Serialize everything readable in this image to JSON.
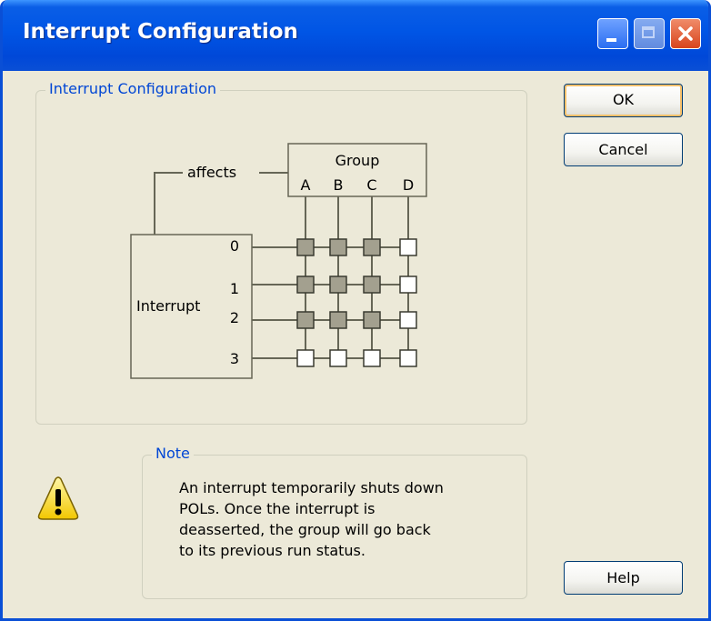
{
  "window": {
    "title": "Interrupt Configuration"
  },
  "config_group": {
    "legend": "Interrupt Configuration"
  },
  "diagram": {
    "affects_label": "affects",
    "group_label": "Group",
    "group_columns": [
      "A",
      "B",
      "C",
      "D"
    ],
    "interrupt_label": "Interrupt",
    "interrupt_rows": [
      "0",
      "1",
      "2",
      "3"
    ],
    "matrix": [
      [
        true,
        true,
        true,
        false
      ],
      [
        true,
        true,
        true,
        false
      ],
      [
        true,
        true,
        true,
        false
      ],
      [
        false,
        false,
        false,
        false
      ]
    ],
    "colors": {
      "filled": "#a3a08f",
      "empty": "#ffffff",
      "line": "#666656"
    }
  },
  "buttons": {
    "ok": "OK",
    "cancel": "Cancel",
    "help": "Help"
  },
  "note": {
    "legend": "Note",
    "text": "An interrupt temporarily shuts down\nPOLs. Once the interrupt is\ndeasserted, the group will go back\nto its previous run status.",
    "icon": "warning-icon"
  }
}
